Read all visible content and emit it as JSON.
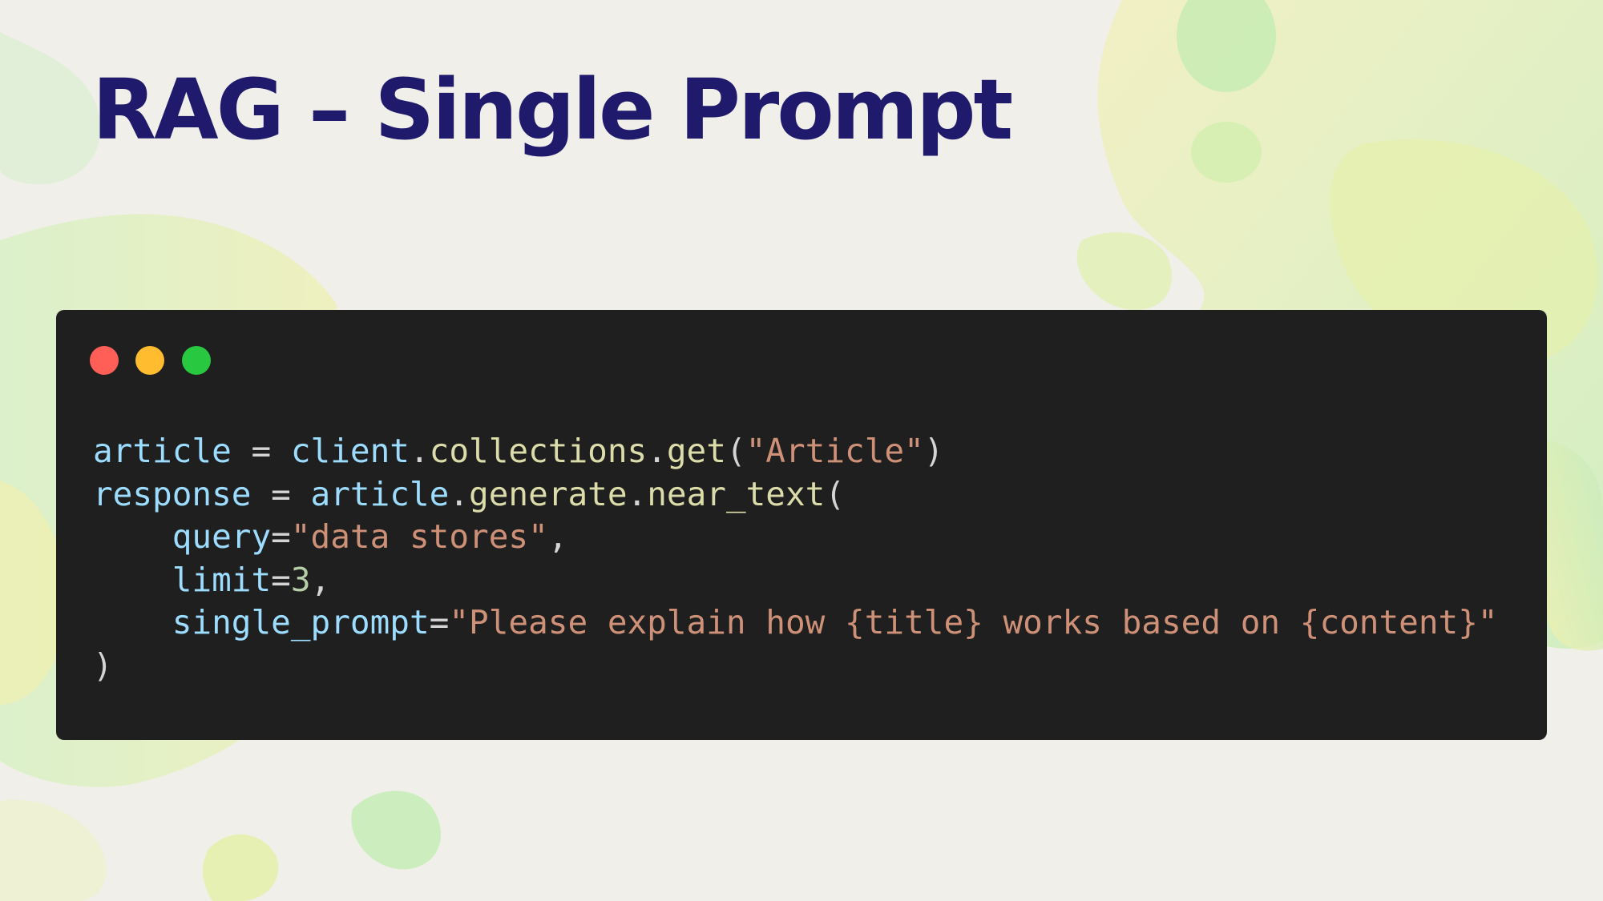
{
  "slide": {
    "title": "RAG – Single Prompt"
  },
  "window_controls": {
    "close_color": "#ff5f57",
    "minimize_color": "#febc2e",
    "maximize_color": "#28c840"
  },
  "code": {
    "line1": {
      "var": "article",
      "eq": " = ",
      "obj": "client",
      "dot1": ".",
      "attr": "collections",
      "dot2": ".",
      "fn": "get",
      "open": "(",
      "str": "\"Article\"",
      "close": ")"
    },
    "line2": {
      "var": "response",
      "eq": " = ",
      "obj": "article",
      "dot1": ".",
      "attr": "generate",
      "dot2": ".",
      "fn": "near_text",
      "open": "("
    },
    "line3": {
      "indent": "    ",
      "param": "query",
      "eq": "=",
      "str": "\"data stores\"",
      "comma": ","
    },
    "line4": {
      "indent": "    ",
      "param": "limit",
      "eq": "=",
      "num": "3",
      "comma": ","
    },
    "line5": {
      "indent": "    ",
      "param": "single_prompt",
      "eq": "=",
      "str": "\"Please explain how {title} works based on {content}\""
    },
    "line6": {
      "close": ")"
    }
  },
  "colors": {
    "title": "#1f1a6b",
    "background": "#f0efe9",
    "code_background": "#1f1f1f",
    "variable": "#9cdcfe",
    "function": "#dcdcaa",
    "string": "#ce9178",
    "number": "#b5cea8"
  }
}
